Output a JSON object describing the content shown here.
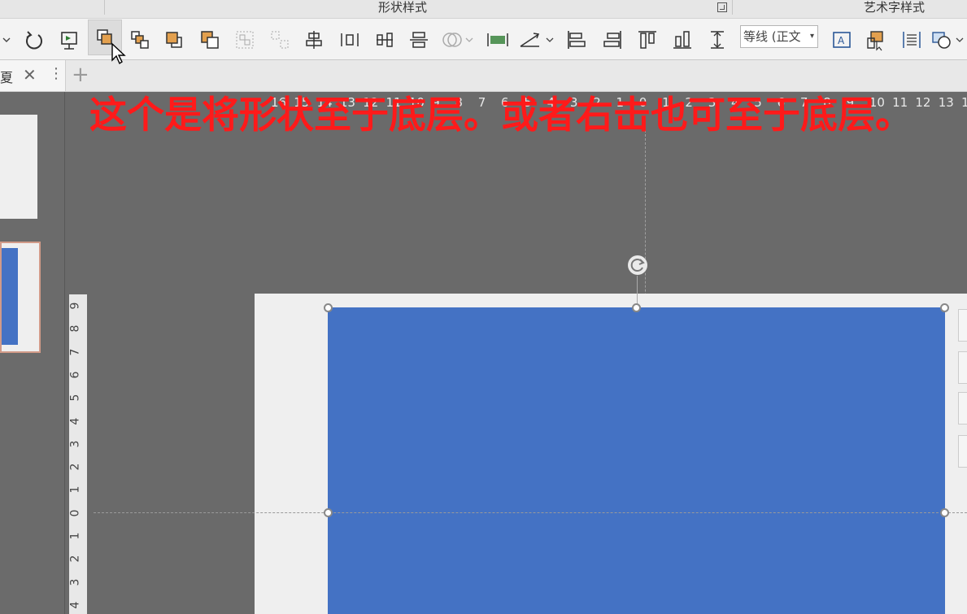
{
  "ribbon": {
    "groups": [
      "形状样式",
      "艺术字样式"
    ],
    "font_name": "等线 (正文"
  },
  "toolbar": {
    "icons": [
      "rotate-icon",
      "selection-pane-icon",
      "send-to-back-icon",
      "bring-forward-icon",
      "bring-to-front-icon",
      "send-backward-icon",
      "group-icon",
      "ungroup-icon",
      "align-center-icon",
      "distribute-horizontal-icon",
      "distribute-center-icon",
      "align-middle-icon",
      "merge-shapes-icon",
      "rotate-flip-icon",
      "edit-shape-icon",
      "align-left-icon",
      "align-right-icon",
      "align-top-icon",
      "align-bottom-icon",
      "distribute-vertical-icon",
      "text-box-icon",
      "shape-select-icon",
      "text-align-icon",
      "insert-shape-icon"
    ]
  },
  "tabs": {
    "doc_tab_label": "夏",
    "close": "✕",
    "more": "⋮",
    "new_tab": "+"
  },
  "ruler": {
    "horizontal": [
      "16",
      "15",
      "14",
      "13",
      "12",
      "11",
      "10",
      "9",
      "8",
      "7",
      "6",
      "5",
      "4",
      "3",
      "2",
      "1",
      "0",
      "1",
      "2",
      "3",
      "4",
      "5",
      "6",
      "7",
      "8",
      "9",
      "10",
      "11",
      "12",
      "13",
      "1"
    ],
    "vertical": [
      "9",
      "8",
      "7",
      "6",
      "5",
      "4",
      "3",
      "2",
      "1",
      "0",
      "1",
      "2",
      "3",
      "4"
    ]
  },
  "annotation": "这个是将形状至于底层。或者右击也可至于底层。",
  "colors": {
    "shape_fill": "#4472c4",
    "annotation": "#ff1a1a",
    "canvas_bg": "#6a6a6a"
  }
}
